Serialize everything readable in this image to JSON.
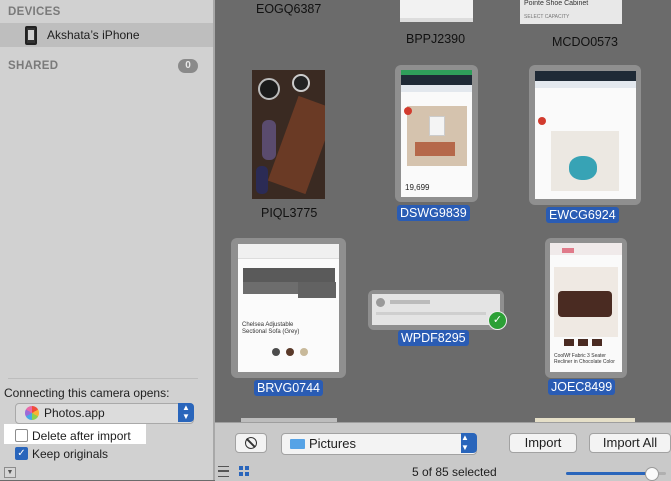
{
  "sidebar": {
    "devices_header": "DEVICES",
    "device_name": "Akshata’s iPhone",
    "shared_header": "SHARED",
    "shared_count": "0",
    "opens_label": "Connecting this camera opens:",
    "opens_app": "Photos.app",
    "delete_label": "Delete after import",
    "delete_checked": false,
    "keep_label": "Keep originals",
    "keep_checked": true
  },
  "grid": {
    "top_labels": [
      "EOGQ6387",
      "BPPJ2390",
      "MCDO0573"
    ],
    "top_right_caption_1": "Pointe Shoe Cabinet",
    "top_right_caption_2": "SELECT CAPACITY",
    "items": [
      {
        "name": "PIQL3775",
        "selected": false
      },
      {
        "name": "DSWG9839",
        "selected": true
      },
      {
        "name": "EWCG6924",
        "selected": true
      },
      {
        "name": "BRVG0744",
        "selected": true
      },
      {
        "name": "WPDF8295",
        "selected": true,
        "imported": true
      },
      {
        "name": "JOEC8499",
        "selected": true
      }
    ],
    "dswg_price": "19,699",
    "brvg_product": "Chelsea Adjustable Sectional Sofa (Grey)",
    "joec_product": "CoolWf Fabric 3 Seater Recliner in Chocolate Color"
  },
  "toolbar": {
    "destination": "Pictures",
    "import_label": "Import",
    "import_all_label": "Import All",
    "count_text": "5 of 85 selected",
    "zoom_level": 0.85
  },
  "colors": {
    "accent": "#2965bb",
    "imported_badge": "#2ca036"
  },
  "icons": [
    "phone-icon",
    "photos-app-icon",
    "stop-icon",
    "folder-icon",
    "list-view-icon",
    "grid-view-icon",
    "checkmark-icon"
  ]
}
